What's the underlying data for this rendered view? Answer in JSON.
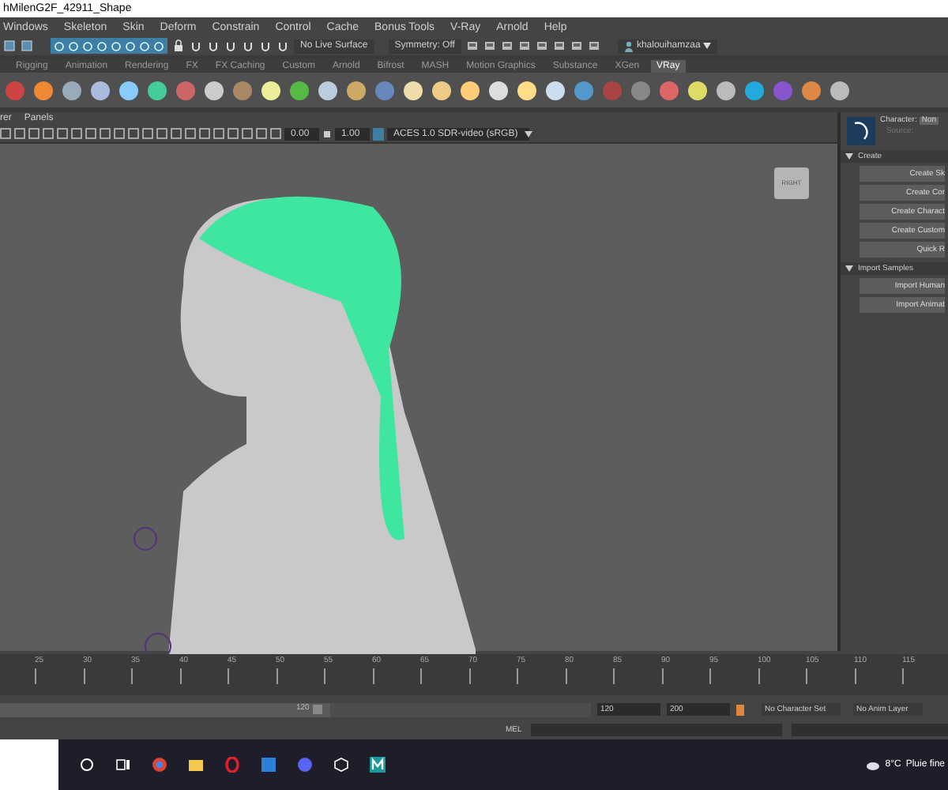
{
  "window": {
    "title": "hMilenG2F_42911_Shape"
  },
  "menu_bar": [
    "Windows",
    "Skeleton",
    "Skin",
    "Deform",
    "Constrain",
    "Control",
    "Cache",
    "Bonus Tools",
    "V-Ray",
    "Arnold",
    "Help"
  ],
  "status_line": {
    "live_surface": "No Live Surface",
    "symmetry": "Symmetry: Off",
    "user": "khalouihamzaa"
  },
  "shelf_tabs": [
    {
      "label": "Rigging",
      "selected": false
    },
    {
      "label": "Animation",
      "selected": false
    },
    {
      "label": "Rendering",
      "selected": false
    },
    {
      "label": "FX",
      "selected": false
    },
    {
      "label": "FX Caching",
      "selected": false
    },
    {
      "label": "Custom",
      "selected": false
    },
    {
      "label": "Arnold",
      "selected": false
    },
    {
      "label": "Bifrost",
      "selected": false
    },
    {
      "label": "MASH",
      "selected": false
    },
    {
      "label": "Motion Graphics",
      "selected": false
    },
    {
      "label": "Substance",
      "selected": false
    },
    {
      "label": "XGen",
      "selected": false
    },
    {
      "label": "VRay",
      "selected": true
    }
  ],
  "panel_menus": [
    "rer",
    "Panels"
  ],
  "panel_toolbar": {
    "exposure": "0.00",
    "gamma": "1.00",
    "color_space": "ACES 1.0 SDR-video (sRGB)"
  },
  "view_cube": {
    "label": "RIGHT"
  },
  "character_controls": {
    "character_label": "Character:",
    "character_value": "Non",
    "source_label": "Source:",
    "sections": [
      {
        "title": "Create",
        "expanded": true,
        "buttons": [
          "Create Sk",
          "Create Cor",
          "Create Charact",
          "Create Custom",
          "Quick R"
        ]
      },
      {
        "title": "Import Samples",
        "expanded": true,
        "buttons": [
          "Import Human",
          "Import Animat"
        ]
      }
    ]
  },
  "time_slider": {
    "ticks": [
      "25",
      "30",
      "35",
      "40",
      "45",
      "50",
      "55",
      "60",
      "65",
      "70",
      "75",
      "80",
      "85",
      "90",
      "95",
      "100",
      "105",
      "110",
      "115"
    ]
  },
  "range_slider": {
    "level": 0.56,
    "end_handle": "120",
    "playback_end": "120",
    "animation_end": "200",
    "character_set": "No Character Set",
    "anim_layer": "No Anim Layer"
  },
  "command_line": {
    "language": "MEL"
  },
  "taskbar": {
    "temperature": "8°C",
    "weather": "Pluie fine"
  }
}
